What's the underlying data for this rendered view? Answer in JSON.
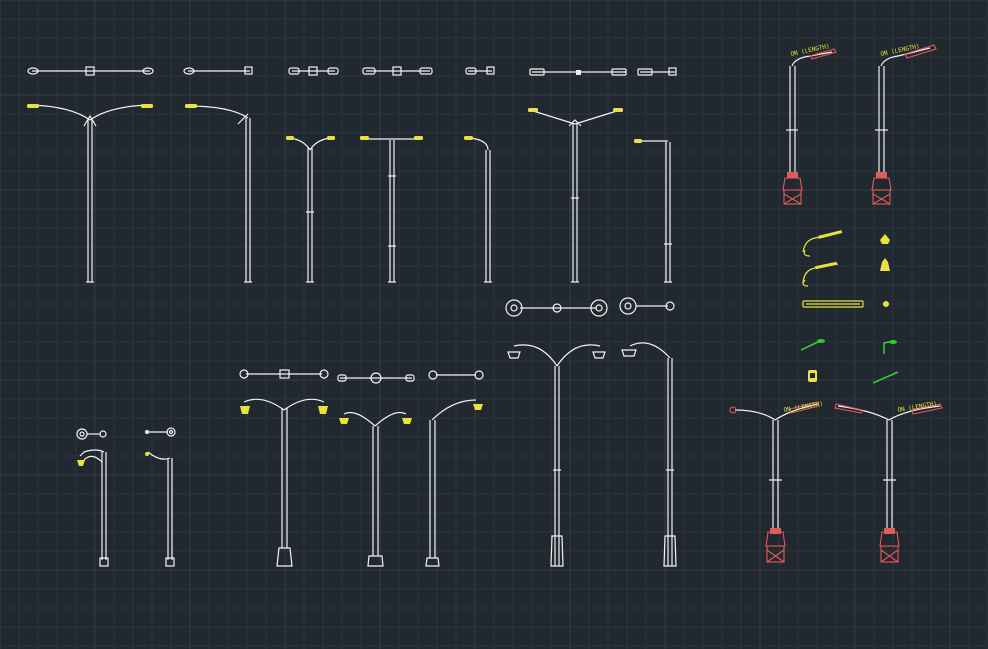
{
  "drawing": {
    "background": "#212830",
    "grid_minor": "#2b333c",
    "grid_major": "#323b45",
    "colors": {
      "line": "#f2f2f2",
      "lamp": "#e8e23a",
      "base": "#e25a5a",
      "symbol": "#33cc33"
    }
  },
  "annotations": [
    {
      "id": "a1",
      "text": "ON (LENGTH)"
    },
    {
      "id": "a2",
      "text": "ON (LENGTH)"
    },
    {
      "id": "a3",
      "text": "ON (LENGTH)"
    },
    {
      "id": "a4",
      "text": "ON (LENGTH)"
    }
  ]
}
